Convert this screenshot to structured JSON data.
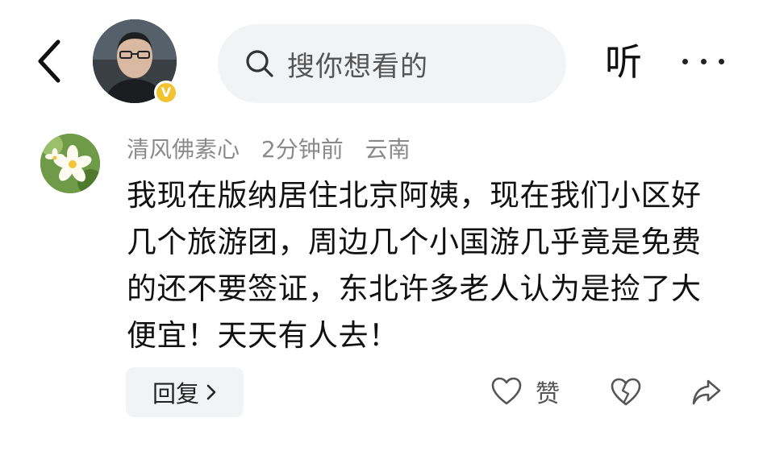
{
  "header": {
    "back_icon": "chevron-left-icon",
    "search_placeholder": "搜你想看的",
    "listen_label": "听",
    "more_icon": "more-dots-icon",
    "avatar_badge": "V",
    "badge_color": "#f2c230"
  },
  "comment": {
    "username": "清风佛素心",
    "time": "2分钟前",
    "location": "云南",
    "text": "我现在版纳居住北京阿姨，现在我们小区好几个旅游团，周边几个小国游几乎竟是免费的还不要签证，东北许多老人认为是捡了大便宜！天天有人去！"
  },
  "actions": {
    "reply_label": "回复",
    "like_label": "赞",
    "like_icon": "heart-outline-icon",
    "dislike_icon": "broken-heart-icon",
    "share_icon": "share-arrow-icon"
  }
}
